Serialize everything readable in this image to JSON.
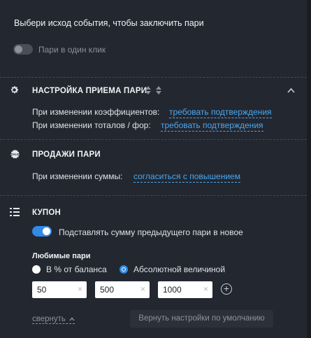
{
  "header": {
    "prompt": "Выбери исход события, чтобы заключить пари",
    "one_click_label": "Пари в один клик",
    "one_click_enabled": false
  },
  "acceptance": {
    "title": "НАСТРОЙКА ПРИЕМА ПАРИ",
    "icon": "gear-icon",
    "odds_change_label": "При изменении коэффициентов:",
    "odds_change_value": "требовать подтверждения",
    "totals_change_label": "При изменении тоталов / фор:",
    "totals_change_value": "требовать подтверждения",
    "expanded": true
  },
  "sales": {
    "title": "ПРОДАЖИ ПАРИ",
    "icon": "sale-badge-icon",
    "amount_change_label": "При изменении суммы:",
    "amount_change_value": "согласиться с повышением"
  },
  "coupon": {
    "title": "КУПОН",
    "icon": "coupon-icon",
    "substitute_label": "Подставлять сумму предыдущего пари в новое",
    "substitute_enabled": true,
    "favorites_title": "Любимые пари",
    "radio_percent_label": "В % от баланса",
    "radio_absolute_label": "Абсолютной величиной",
    "selected_mode": "absolute",
    "amounts": [
      "50",
      "500",
      "1000"
    ]
  },
  "footer": {
    "collapse_label": "свернуть",
    "reset_label": "Вернуть настройки по умолчанию"
  },
  "colors": {
    "background": "#232730",
    "accent": "#2f8be6",
    "link": "#4aa8f0",
    "muted": "#8d919a"
  }
}
